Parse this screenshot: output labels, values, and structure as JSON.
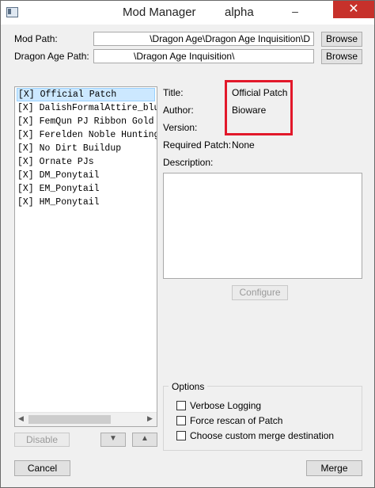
{
  "window": {
    "title": "Mod Manager",
    "subtitle": "alpha",
    "minimize_glyph": "–",
    "close_glyph": "✕"
  },
  "paths": {
    "mod_path_label": "Mod Path:",
    "mod_path_value": "\\Dragon Age\\Dragon Age Inquisition\\D",
    "dragon_age_path_label": "Dragon Age Path:",
    "dragon_age_path_value": "\\Dragon Age Inquisition\\",
    "browse_label": "Browse"
  },
  "mods": {
    "items": [
      "[X] Official Patch",
      "[X] DalishFormalAttire_blue",
      "[X] FemQun PJ Ribbon Gold",
      "[X] Ferelden Noble Hunting A",
      "[X] No Dirt Buildup",
      "[X] Ornate PJs",
      "[X] DM_Ponytail",
      "[X] EM_Ponytail",
      "[X] HM_Ponytail"
    ],
    "selected_index": 0
  },
  "details": {
    "title_label": "Title:",
    "title_value": "Official Patch",
    "author_label": "Author:",
    "author_value": "Bioware",
    "version_label": "Version:",
    "version_value": "",
    "required_patch_label": "Required Patch:",
    "required_patch_value": "None",
    "description_label": "Description:",
    "configure_label": "Configure"
  },
  "list_controls": {
    "disable_label": "Disable",
    "move_down_glyph": "▼",
    "move_up_glyph": "▲",
    "scroll_left_glyph": "◀",
    "scroll_right_glyph": "▶"
  },
  "options": {
    "title": "Options",
    "verbose_logging": "Verbose Logging",
    "force_rescan": "Force rescan of Patch",
    "custom_merge": "Choose custom merge destination"
  },
  "footer": {
    "cancel_label": "Cancel",
    "merge_label": "Merge"
  },
  "colors": {
    "highlight_border": "#e2182a",
    "close_button": "#c7312b",
    "selected_item": "#cce8ff"
  }
}
